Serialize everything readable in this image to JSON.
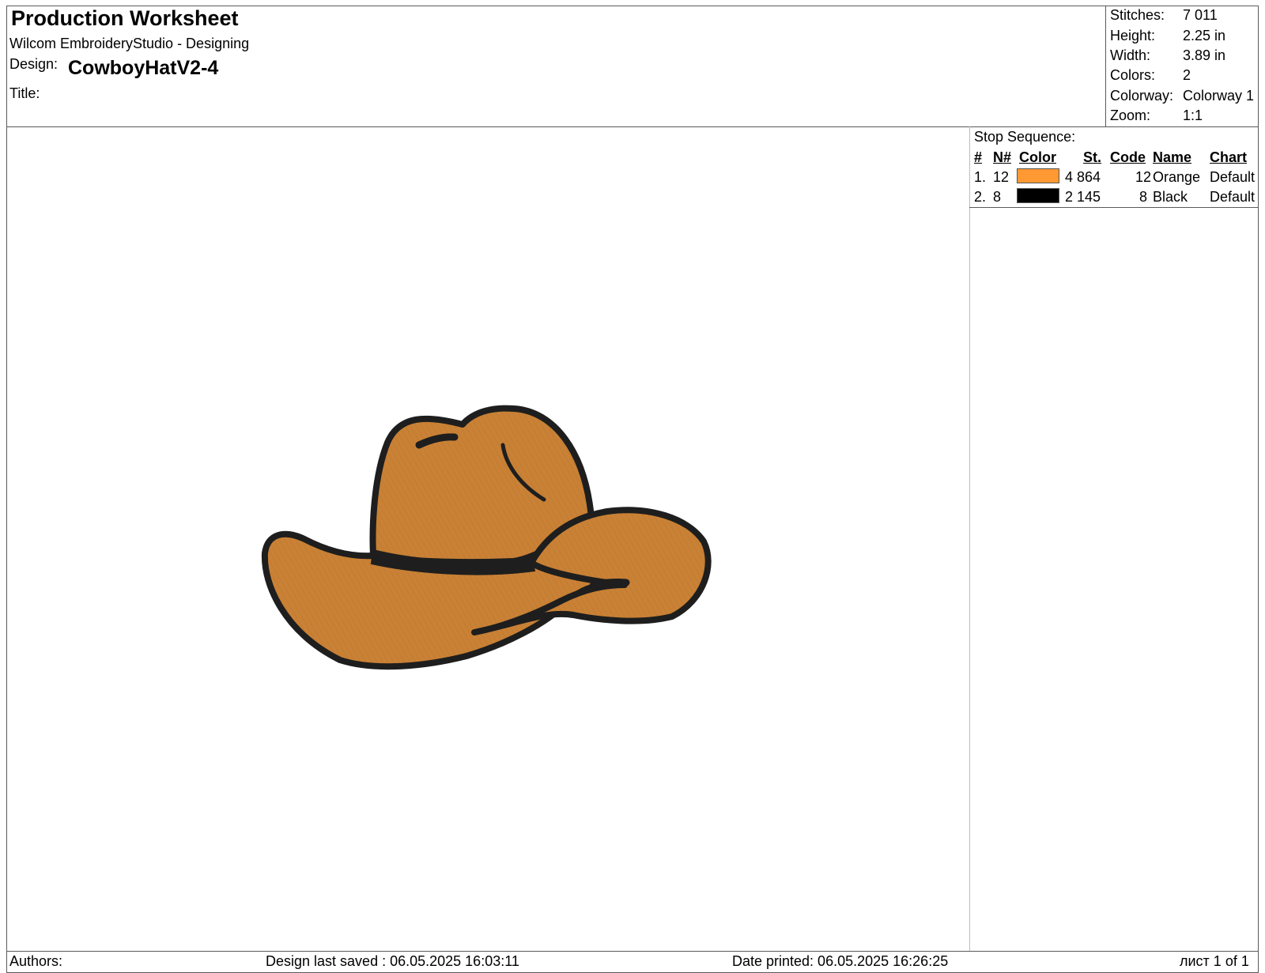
{
  "header": {
    "title": "Production Worksheet",
    "subtitle": "Wilcom EmbroideryStudio - Designing",
    "design_label": "Design:",
    "design_value": "CowboyHatV2-4",
    "title_label": "Title:"
  },
  "stats": [
    {
      "label": "Stitches:",
      "value": "7 011"
    },
    {
      "label": "Height:",
      "value": "2.25 in"
    },
    {
      "label": "Width:",
      "value": "3.89 in"
    },
    {
      "label": "Colors:",
      "value": "2"
    },
    {
      "label": "Colorway:",
      "value": "Colorway 1"
    },
    {
      "label": "Zoom:",
      "value": "1:1"
    }
  ],
  "stop_sequence": {
    "title": "Stop Sequence:",
    "headers": {
      "num": "#",
      "needle": "N#",
      "color": "Color",
      "stitches": "St.",
      "code": "Code",
      "name": "Name",
      "chart": "Chart"
    },
    "rows": [
      {
        "num": "1.",
        "needle": "12",
        "color": "#FF9933",
        "stitches": "4 864",
        "code": "12",
        "name": "Orange",
        "chart": "Default"
      },
      {
        "num": "2.",
        "needle": "8",
        "color": "#000000",
        "stitches": "2 145",
        "code": "8",
        "name": "Black",
        "chart": "Default"
      }
    ]
  },
  "design": {
    "icon": "cowboy-hat",
    "fill_color": "#C98135",
    "outline_color": "#1E1E1E"
  },
  "footer": {
    "authors": "Authors:",
    "last_saved": "Design last saved : 06.05.2025 16:03:11",
    "date_printed": "Date printed: 06.05.2025 16:26:25",
    "page": "лист 1 of 1"
  }
}
